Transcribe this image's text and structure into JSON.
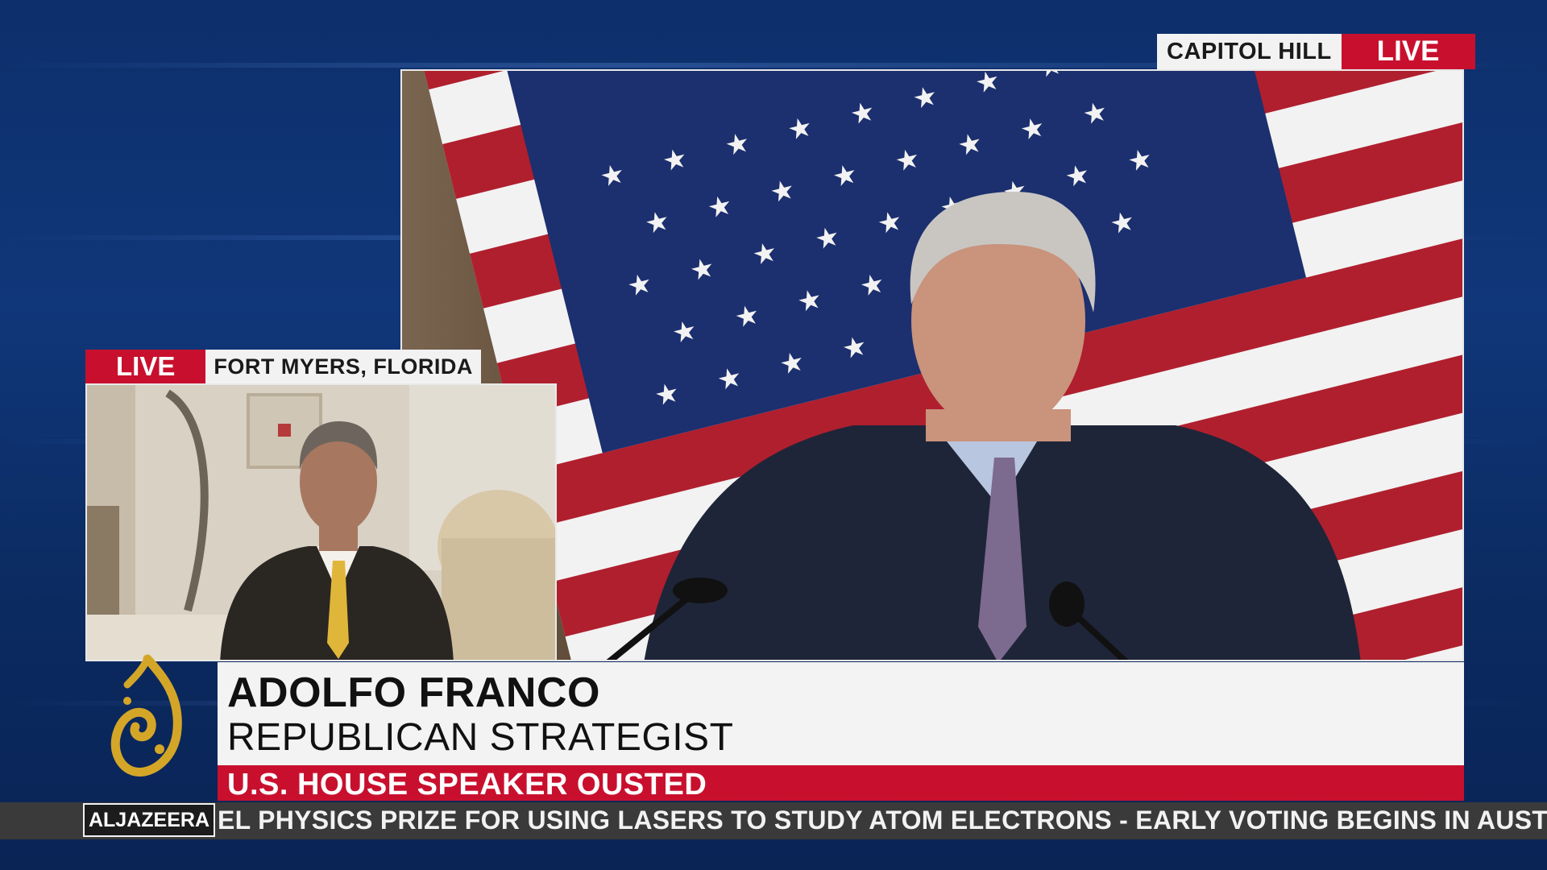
{
  "main_feed": {
    "location": "CAPITOL HILL",
    "live_label": "LIVE"
  },
  "pip_feed": {
    "live_label": "LIVE",
    "location": "FORT MYERS, FLORIDA"
  },
  "lower_third": {
    "name": "ADOLFO FRANCO",
    "role": "REPUBLICAN STRATEGIST",
    "headline": "U.S. HOUSE SPEAKER OUSTED"
  },
  "ticker": {
    "brand": "ALJAZEERA",
    "text": "EL PHYSICS PRIZE FOR USING LASERS TO STUDY ATOM ELECTRONS   -   EARLY VOTING BEGINS IN AUSTRAL"
  },
  "colors": {
    "accent_red": "#c8102e",
    "background_blue": "#10377a",
    "ticker_gray": "#3a3a3a"
  },
  "icons": {
    "logo": "aljazeera-logo-icon"
  }
}
